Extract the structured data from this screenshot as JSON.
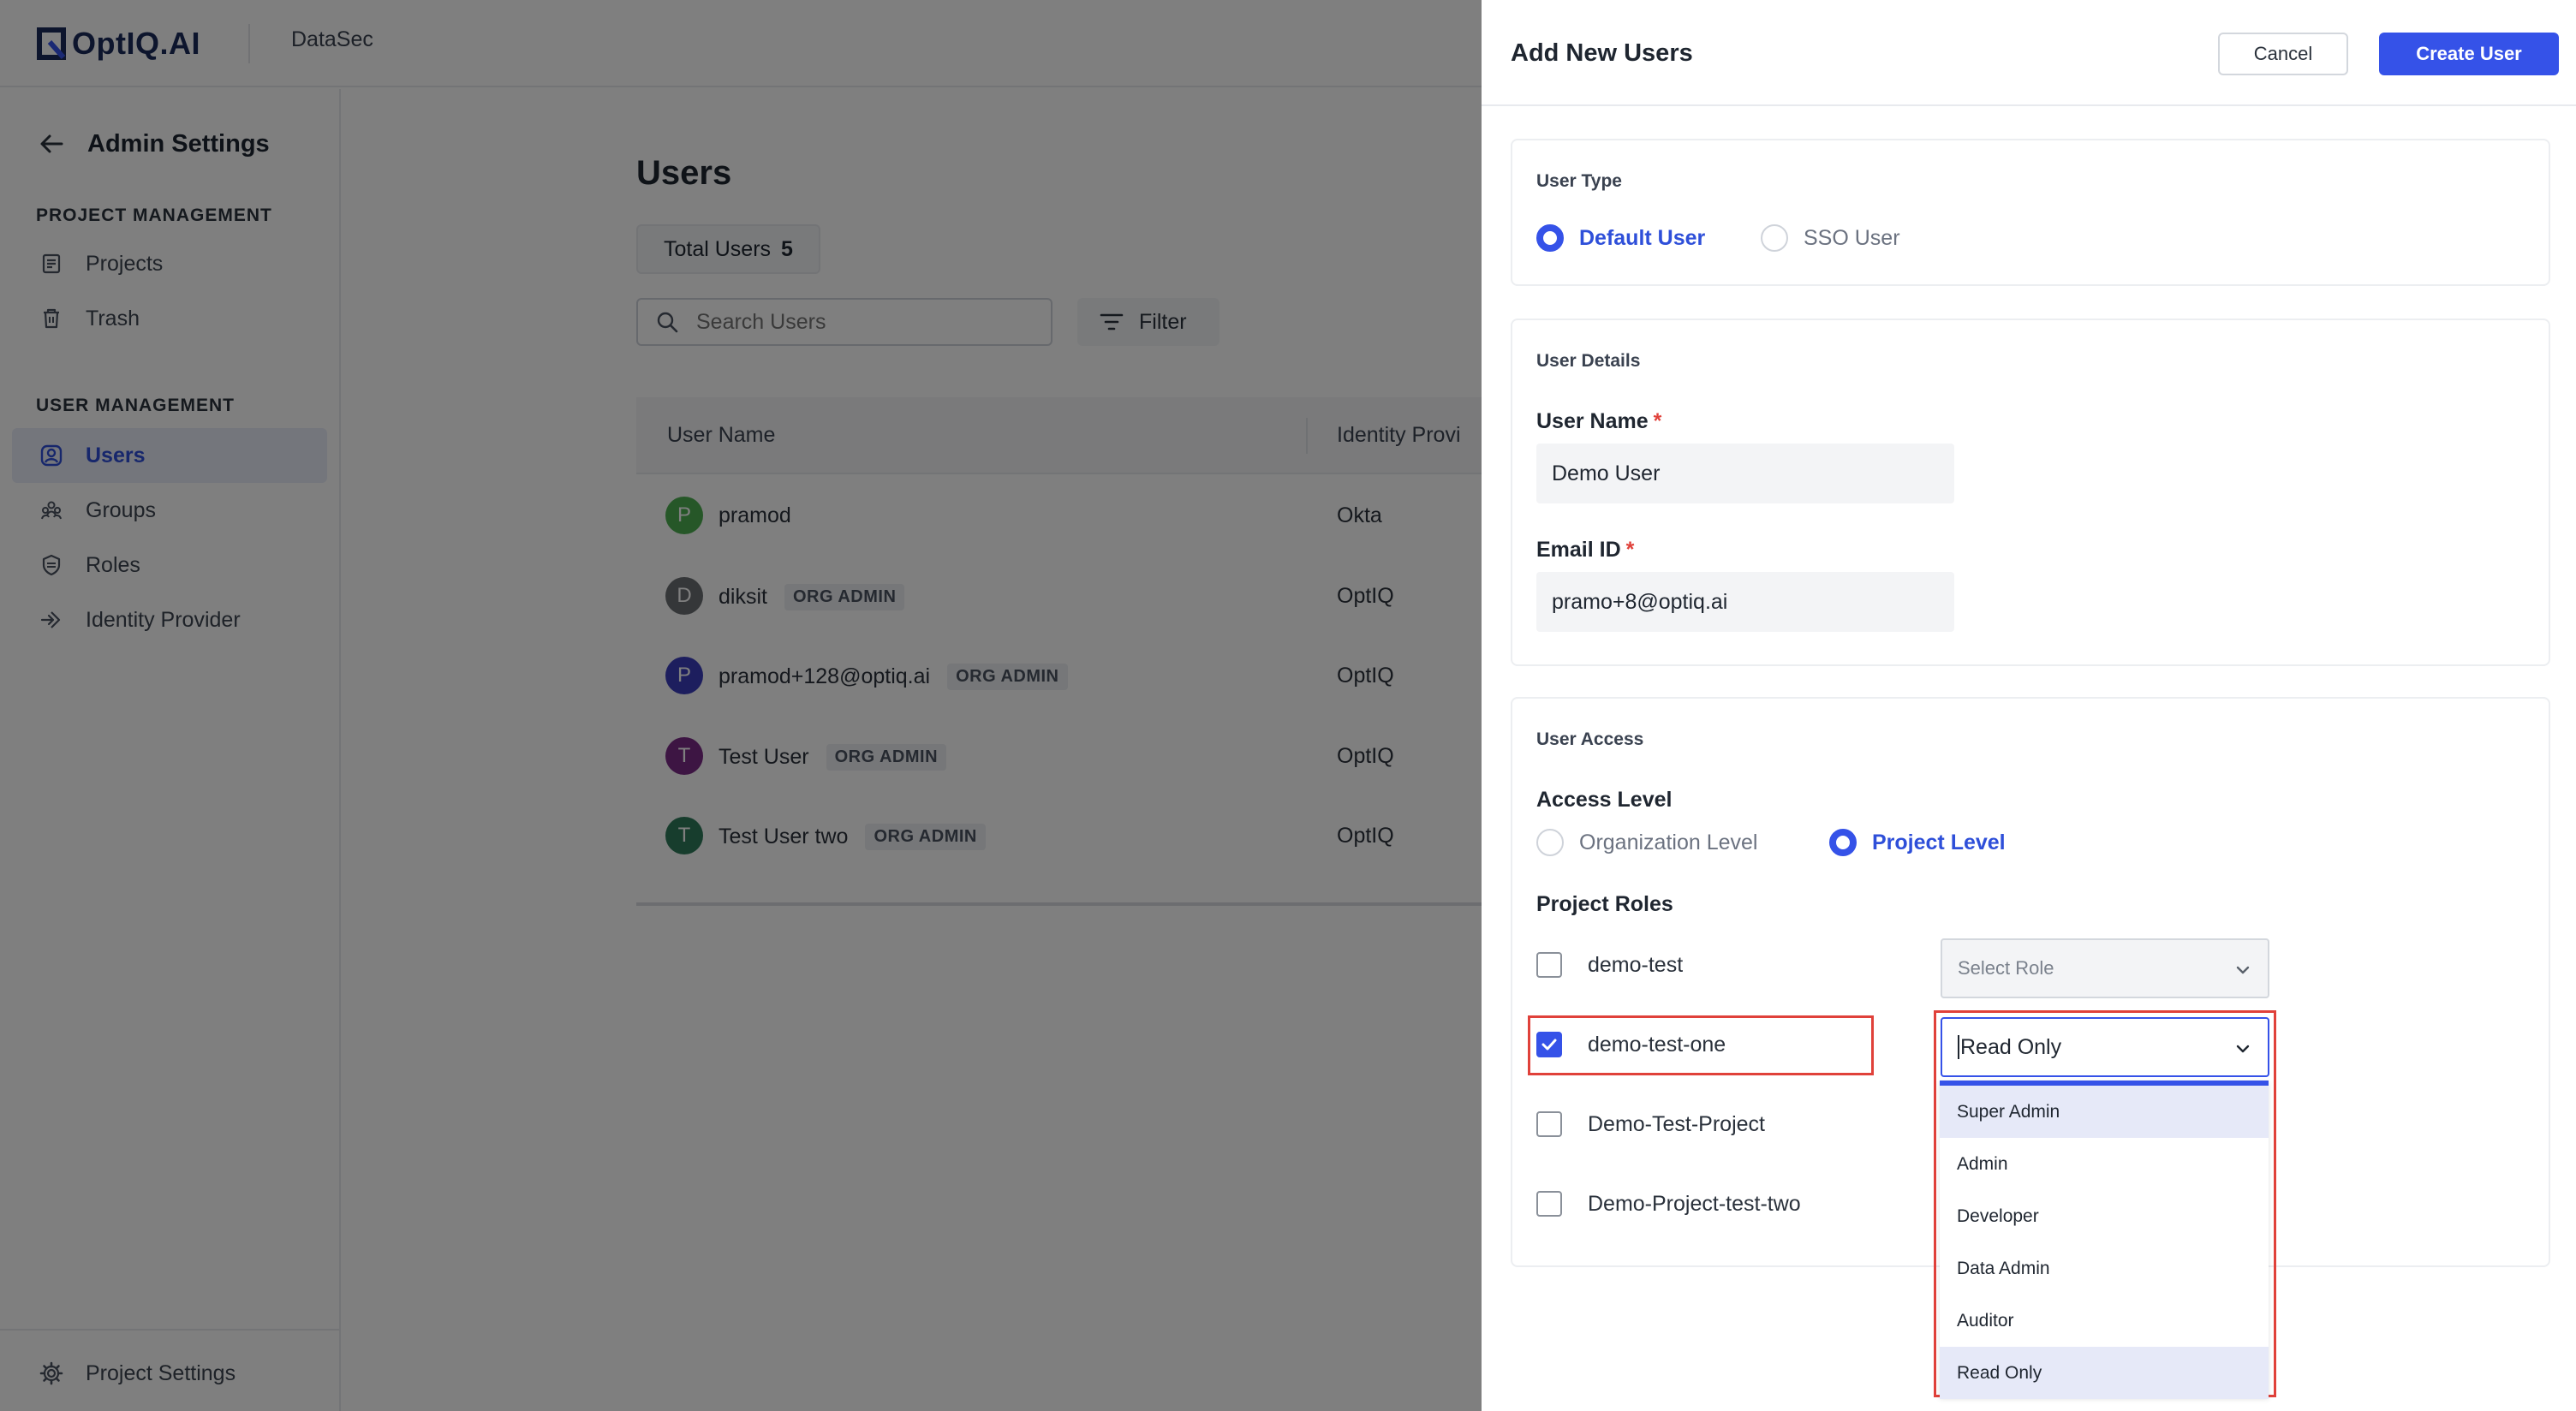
{
  "header": {
    "logo_text": "OptIQ.AI",
    "app_name": "DataSec"
  },
  "sidebar": {
    "title": "Admin Settings",
    "sections": [
      {
        "label": "PROJECT MANAGEMENT",
        "items": [
          {
            "label": "Projects",
            "icon": "document-icon"
          },
          {
            "label": "Trash",
            "icon": "trash-icon"
          }
        ]
      },
      {
        "label": "USER MANAGEMENT",
        "items": [
          {
            "label": "Users",
            "icon": "user-circle-icon",
            "active": true
          },
          {
            "label": "Groups",
            "icon": "group-icon"
          },
          {
            "label": "Roles",
            "icon": "shield-icon"
          },
          {
            "label": "Identity Provider",
            "icon": "login-icon"
          }
        ]
      }
    ],
    "bottom": {
      "label": "Project Settings",
      "icon": "gear-icon"
    }
  },
  "main": {
    "title": "Users",
    "total_label": "Total Users",
    "total_count": "5",
    "search_placeholder": "Search Users",
    "filter_label": "Filter",
    "columns": [
      "User Name",
      "Identity Provi"
    ],
    "rows": [
      {
        "initial": "P",
        "name": "pramod",
        "badge": "",
        "idp": "Okta",
        "avatar_color": "#4caf50"
      },
      {
        "initial": "D",
        "name": "diksit",
        "badge": "ORG ADMIN",
        "idp": "OptIQ",
        "avatar_color": "#6b6f73"
      },
      {
        "initial": "P",
        "name": "pramod+128@optiq.ai",
        "badge": "ORG ADMIN",
        "idp": "OptIQ",
        "avatar_color": "#3b3dbd"
      },
      {
        "initial": "T",
        "name": "Test User",
        "badge": "ORG ADMIN",
        "idp": "OptIQ",
        "avatar_color": "#7b2a86"
      },
      {
        "initial": "T",
        "name": "Test User two",
        "badge": "ORG ADMIN",
        "idp": "OptIQ",
        "avatar_color": "#2f7a5a"
      }
    ]
  },
  "drawer": {
    "title": "Add New Users",
    "cancel_label": "Cancel",
    "create_label": "Create User",
    "user_type": {
      "label": "User Type",
      "options": [
        {
          "label": "Default User",
          "checked": true
        },
        {
          "label": "SSO User",
          "checked": false
        }
      ]
    },
    "user_details": {
      "label": "User Details",
      "name_label": "User Name",
      "name_value": "Demo User",
      "email_label": "Email ID",
      "email_value": "pramo+8@optiq.ai",
      "required_mark": "*"
    },
    "user_access": {
      "label": "User Access",
      "access_level_label": "Access Level",
      "access_options": [
        {
          "label": "Organization Level",
          "checked": false
        },
        {
          "label": "Project Level",
          "checked": true
        }
      ],
      "project_roles_label": "Project Roles",
      "projects": [
        {
          "name": "demo-test",
          "checked": false,
          "role": "Select Role"
        },
        {
          "name": "demo-test-one",
          "checked": true,
          "role": "Read Only"
        },
        {
          "name": "Demo-Test-Project",
          "checked": false,
          "role": ""
        },
        {
          "name": "Demo-Project-test-two",
          "checked": false,
          "role": ""
        }
      ],
      "role_options": [
        "Super Admin",
        "Admin",
        "Developer",
        "Data Admin",
        "Auditor",
        "Read Only"
      ]
    }
  },
  "colors": {
    "accent": "#3552e8",
    "highlight": "#e0413a",
    "active_nav_bg": "#e9edf9"
  }
}
